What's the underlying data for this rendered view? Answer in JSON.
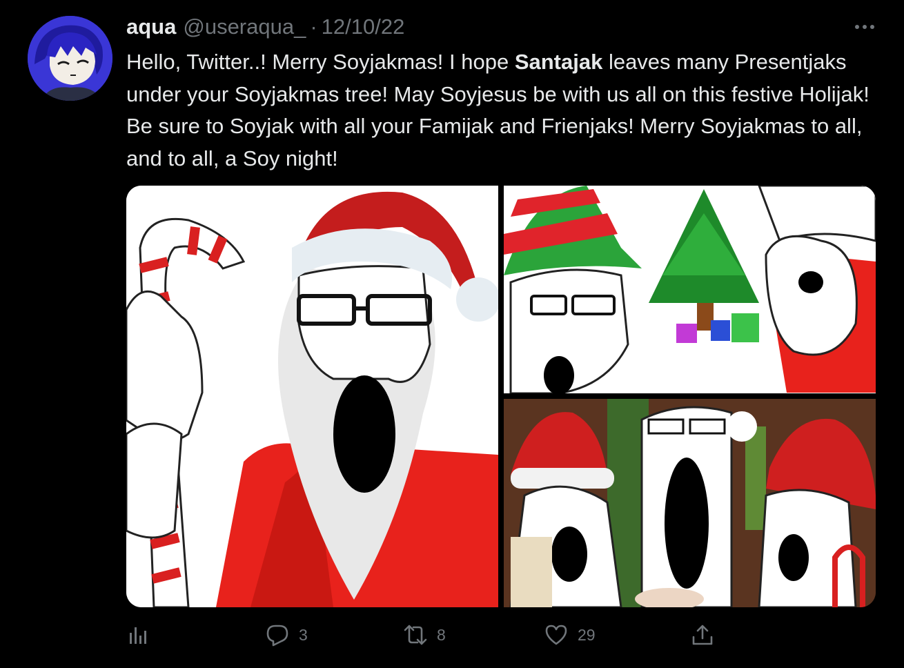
{
  "author": {
    "display_name": "aqua",
    "handle": "@useraqua_",
    "separator": "·",
    "date": "12/10/22",
    "avatar_icon": "anime-avatar"
  },
  "more_icon": "more-horizontal-icon",
  "tweet": {
    "text_before": "Hello, Twitter..! Merry Soyjakmas! I hope ",
    "text_bold": "Santajak",
    "text_after": " leaves many Presentjaks under your Soyjakmas tree! May Soyjesus be with us all on this festive Holijak! Be sure to Soyjak with all your Famijak and Frienjaks! Merry Soyjakmas to all, and to all, a Soy night!"
  },
  "media": [
    {
      "description_icon": "santa-soyjak-candy-cane-image"
    },
    {
      "description_icon": "elf-santa-christmas-tree-image"
    },
    {
      "description_icon": "soyjaks-santa-hats-cocoa-image"
    }
  ],
  "actions": {
    "views_icon": "analytics-icon",
    "reply_icon": "reply-icon",
    "reply_count": "3",
    "retweet_icon": "retweet-icon",
    "retweet_count": "8",
    "like_icon": "heart-icon",
    "like_count": "29",
    "share_icon": "share-icon"
  },
  "colors": {
    "background": "#000000",
    "text_primary": "#e7e9ea",
    "text_secondary": "#71767b",
    "avatar_bg": "#3a36d6"
  }
}
